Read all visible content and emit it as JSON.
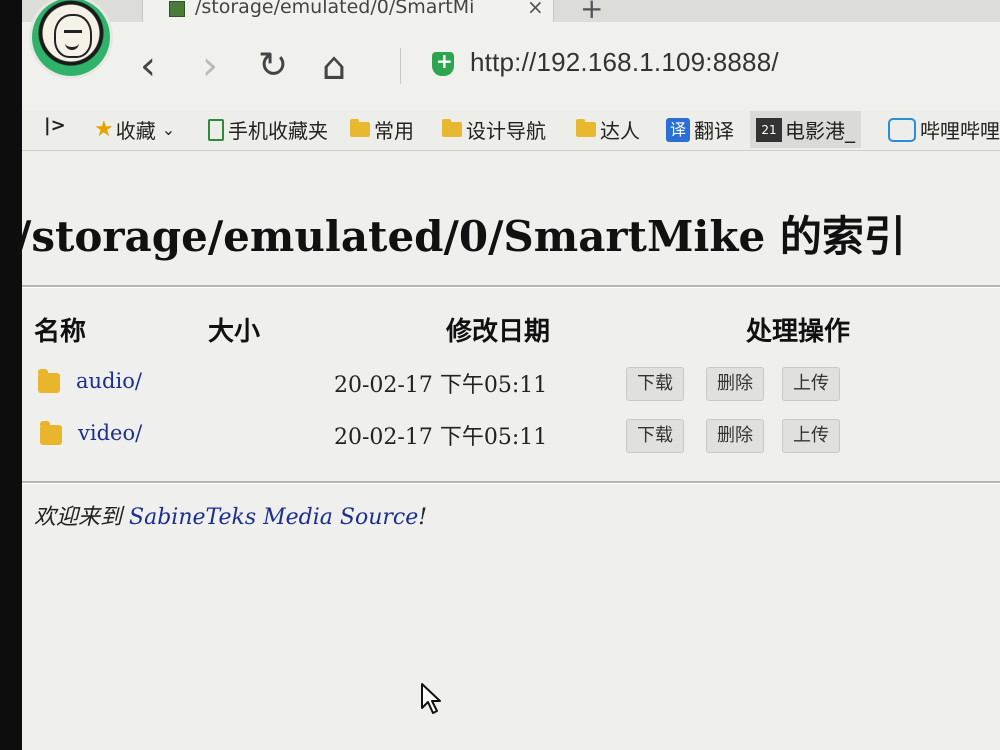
{
  "browser": {
    "tab": {
      "title": "/storage/emulated/0/SmartMi",
      "close": "×"
    },
    "new_tab": "+",
    "url": "http://192.168.1.109:8888/",
    "nav": {
      "back": "‹",
      "forward": "›",
      "reload": "↻",
      "home": "⌂"
    },
    "bookmarks": [
      {
        "label": "收藏",
        "icon": "star-icon",
        "suffix": "⌄"
      },
      {
        "label": "手机收藏夹",
        "icon": "phone-icon"
      },
      {
        "label": "常用",
        "icon": "folder-icon"
      },
      {
        "label": "设计导航",
        "icon": "folder-icon"
      },
      {
        "label": "达人",
        "icon": "folder-icon"
      },
      {
        "label": "翻译",
        "icon": "translate-icon",
        "icon_text": "译"
      },
      {
        "label": "电影港_",
        "icon": "movie-icon",
        "icon_text": "21"
      },
      {
        "label": "哔哩哔哩",
        "icon": "bili-icon"
      }
    ],
    "sidebar_toggle": "|>"
  },
  "page": {
    "title": "/storage/emulated/0/SmartMike 的索引",
    "columns": {
      "name": "名称",
      "size": "大小",
      "date": "修改日期",
      "actions": "处理操作"
    },
    "rows": [
      {
        "name": "audio/",
        "size": "",
        "date": "20-02-17 下午05:11"
      },
      {
        "name": "video/",
        "size": "",
        "date": "20-02-17 下午05:11"
      }
    ],
    "actions": {
      "download": "下载",
      "delete": "删除",
      "upload": "上传"
    },
    "footer": {
      "prefix": "欢迎来到",
      "link": "SabineTeks Media Source",
      "suffix": "!"
    }
  }
}
